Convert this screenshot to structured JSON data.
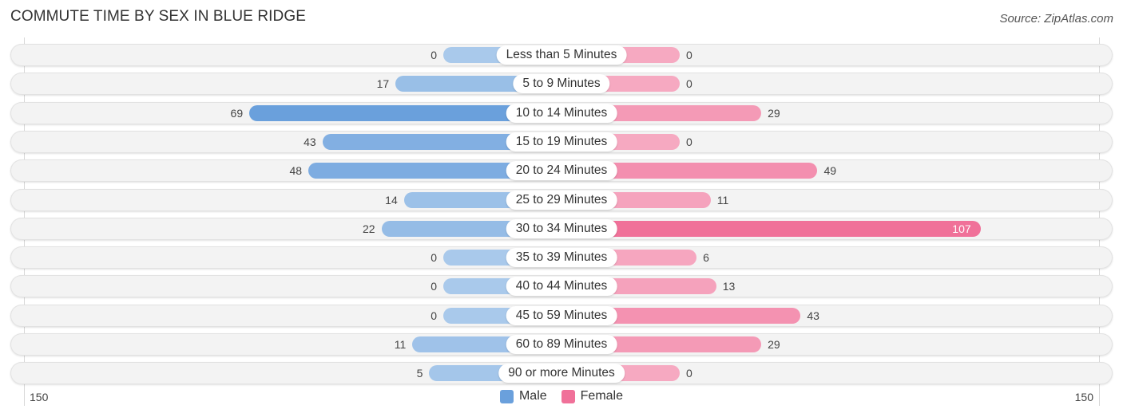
{
  "title": "COMMUTE TIME BY SEX IN BLUE RIDGE",
  "source": "Source: ZipAtlas.com",
  "colors": {
    "male": "#6aa0dc",
    "female": "#f07199",
    "male_light": "#a9c9eb",
    "female_light": "#f6a9c1"
  },
  "chart_data": {
    "type": "bar",
    "orientation": "horizontal-diverging",
    "title": "COMMUTE TIME BY SEX IN BLUE RIDGE",
    "categories": [
      "Less than 5 Minutes",
      "5 to 9 Minutes",
      "10 to 14 Minutes",
      "15 to 19 Minutes",
      "20 to 24 Minutes",
      "25 to 29 Minutes",
      "30 to 34 Minutes",
      "35 to 39 Minutes",
      "40 to 44 Minutes",
      "45 to 59 Minutes",
      "60 to 89 Minutes",
      "90 or more Minutes"
    ],
    "series": [
      {
        "name": "Male",
        "values": [
          0,
          17,
          69,
          43,
          48,
          14,
          22,
          0,
          0,
          0,
          11,
          5
        ]
      },
      {
        "name": "Female",
        "values": [
          0,
          0,
          29,
          0,
          49,
          11,
          107,
          6,
          13,
          43,
          29,
          0
        ]
      }
    ],
    "axis_min_label": "150",
    "axis_max_label": "150",
    "xlim": [
      -150,
      150
    ],
    "legend": {
      "position": "bottom-center",
      "entries": [
        "Male",
        "Female"
      ]
    },
    "grid": false
  },
  "legend": {
    "male_label": "Male",
    "female_label": "Female"
  },
  "axis": {
    "left": "150",
    "right": "150"
  }
}
